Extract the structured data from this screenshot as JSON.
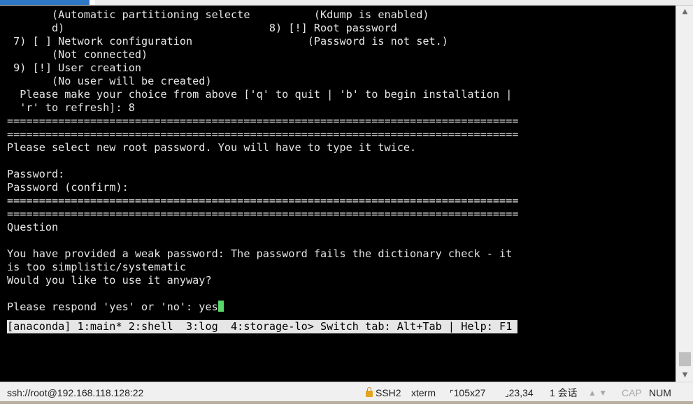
{
  "terminal": {
    "lines": [
      "       (Automatic partitioning selecte          (Kdump is enabled)",
      "       d)                                8) [!] Root password",
      " 7) [ ] Network configuration                  (Password is not set.)",
      "       (Not connected)",
      " 9) [!] User creation",
      "       (No user will be created)",
      "  Please make your choice from above ['q' to quit | 'b' to begin installation |",
      "  'r' to refresh]: 8",
      "================================================================================",
      "================================================================================",
      "Please select new root password. You will have to type it twice.",
      "",
      "Password:",
      "Password (confirm):",
      "================================================================================",
      "================================================================================",
      "Question",
      "",
      "You have provided a weak password: The password fails the dictionary check - it",
      "is too simplistic/systematic",
      "Would you like to use it anyway?",
      "",
      "Please respond 'yes' or 'no': yes"
    ],
    "tmux_status": "[anaconda] 1:main* 2:shell  3:log  4:storage-lo> Switch tab: Alt+Tab | Help: F1"
  },
  "statusbar": {
    "session": "ssh://root@192.168.118.128:22",
    "protocol": "SSH2",
    "term_type": "xterm",
    "size": "105x27",
    "cursor_pos": "23,34",
    "sessions": "1 会话",
    "caps": "CAP",
    "num": "NUM"
  }
}
